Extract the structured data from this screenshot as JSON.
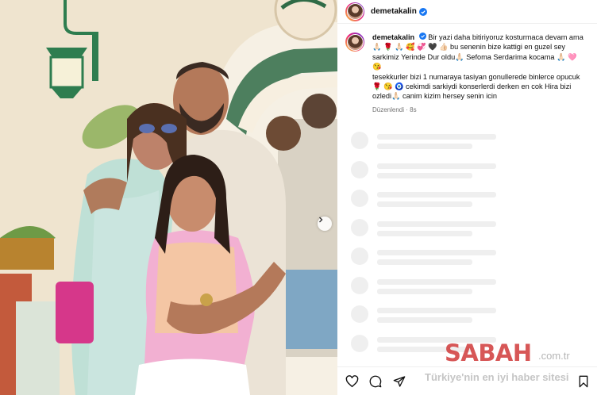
{
  "post": {
    "username": "demetakalin",
    "caption": {
      "username": "demetakalin",
      "line1": "Bir yazi daha bitiriyoruz kosturmaca devam ama",
      "line2": "bu senenin bize kattigi en guzel sey",
      "line3a": "sarkimiz Yerinde Dur oldu",
      "line3b": "Sefoma Serdarima kocama",
      "line4": "tesekkurler bizi 1 numaraya tasiyan gonullerede binlerce opucuk",
      "line5": "cekimdi sarkiydi konserlerdi derken en cok Hira bizi",
      "line6a": "ozledi",
      "line6b": "canim kizim hersey senin icin",
      "edited": "Düzenlendi",
      "time": "8s"
    }
  },
  "colors": {
    "verified": "#1877f2",
    "skeleton": "#efefef",
    "meta_text": "#737373"
  },
  "icons": {
    "verified": "verified-badge-icon",
    "next": "chevron-right-icon",
    "like": "heart-icon",
    "comment": "comment-icon",
    "share": "paper-plane-icon",
    "save": "bookmark-icon"
  },
  "watermark": {
    "logo": "SABAH",
    "domain": ".com.tr",
    "tagline": "Türkiye'nin en iyi haber sitesi"
  }
}
